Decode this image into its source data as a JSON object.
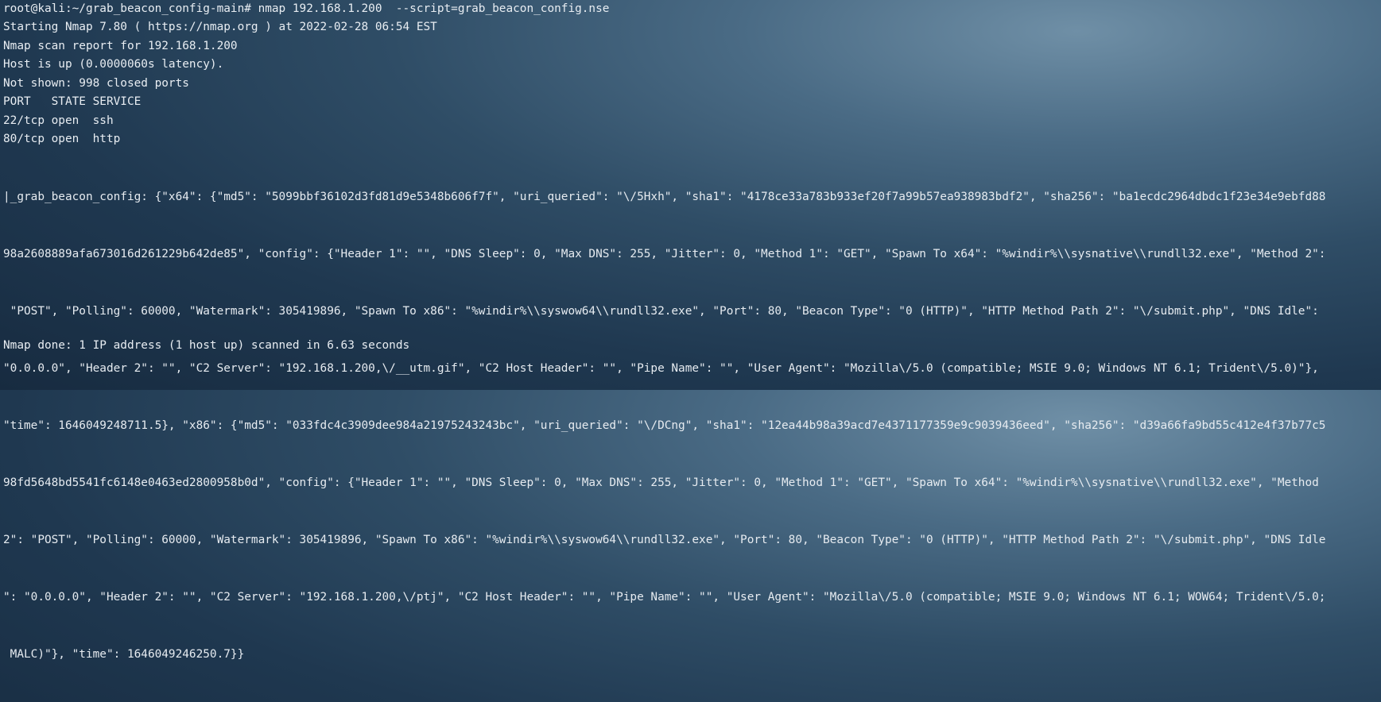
{
  "terminal": {
    "prompt": "root@kali:~/grab_beacon_config-main# nmap 192.168.1.200  --script=grab_beacon_config.nse",
    "lines": [
      "Starting Nmap 7.80 ( https://nmap.org ) at 2022-02-28 06:54 EST",
      "Nmap scan report for 192.168.1.200",
      "Host is up (0.0000060s latency).",
      "Not shown: 998 closed ports",
      "PORT   STATE SERVICE",
      "22/tcp open  ssh",
      "80/tcp open  http"
    ],
    "script_output": [
      "|_grab_beacon_config: {\"x64\": {\"md5\": \"5099bbf36102d3fd81d9e5348b606f7f\", \"uri_queried\": \"\\/5Hxh\", \"sha1\": \"4178ce33a783b933ef20f7a99b57ea938983bdf2\", \"sha256\": \"ba1ecdc2964dbdc1f23e34e9ebfd88",
      "98a2608889afa673016d261229b642de85\", \"config\": {\"Header 1\": \"\", \"DNS Sleep\": 0, \"Max DNS\": 255, \"Jitter\": 0, \"Method 1\": \"GET\", \"Spawn To x64\": \"%windir%\\\\sysnative\\\\rundll32.exe\", \"Method 2\":",
      " \"POST\", \"Polling\": 60000, \"Watermark\": 305419896, \"Spawn To x86\": \"%windir%\\\\syswow64\\\\rundll32.exe\", \"Port\": 80, \"Beacon Type\": \"0 (HTTP)\", \"HTTP Method Path 2\": \"\\/submit.php\", \"DNS Idle\":",
      "\"0.0.0.0\", \"Header 2\": \"\", \"C2 Server\": \"192.168.1.200,\\/__utm.gif\", \"C2 Host Header\": \"\", \"Pipe Name\": \"\", \"User Agent\": \"Mozilla\\/5.0 (compatible; MSIE 9.0; Windows NT 6.1; Trident\\/5.0)\"},",
      "\"time\": 1646049248711.5}, \"x86\": {\"md5\": \"033fdc4c3909dee984a21975243243bc\", \"uri_queried\": \"\\/DCng\", \"sha1\": \"12ea44b98a39acd7e4371177359e9c9039436eed\", \"sha256\": \"d39a66fa9bd55c412e4f37b77c5",
      "98fd5648bd5541fc6148e0463ed2800958b0d\", \"config\": {\"Header 1\": \"\", \"DNS Sleep\": 0, \"Max DNS\": 255, \"Jitter\": 0, \"Method 1\": \"GET\", \"Spawn To x64\": \"%windir%\\\\sysnative\\\\rundll32.exe\", \"Method",
      "2\": \"POST\", \"Polling\": 60000, \"Watermark\": 305419896, \"Spawn To x86\": \"%windir%\\\\syswow64\\\\rundll32.exe\", \"Port\": 80, \"Beacon Type\": \"0 (HTTP)\", \"HTTP Method Path 2\": \"\\/submit.php\", \"DNS Idle",
      "\": \"0.0.0.0\", \"Header 2\": \"\", \"C2 Server\": \"192.168.1.200,\\/ptj\", \"C2 Host Header\": \"\", \"Pipe Name\": \"\", \"User Agent\": \"Mozilla\\/5.0 (compatible; MSIE 9.0; Windows NT 6.1; WOW64; Trident\\/5.0;",
      " MALC)\"}, \"time\": 1646049246250.7}}"
    ],
    "done_line": "Nmap done: 1 IP address (1 host up) scanned in 6.63 seconds"
  }
}
